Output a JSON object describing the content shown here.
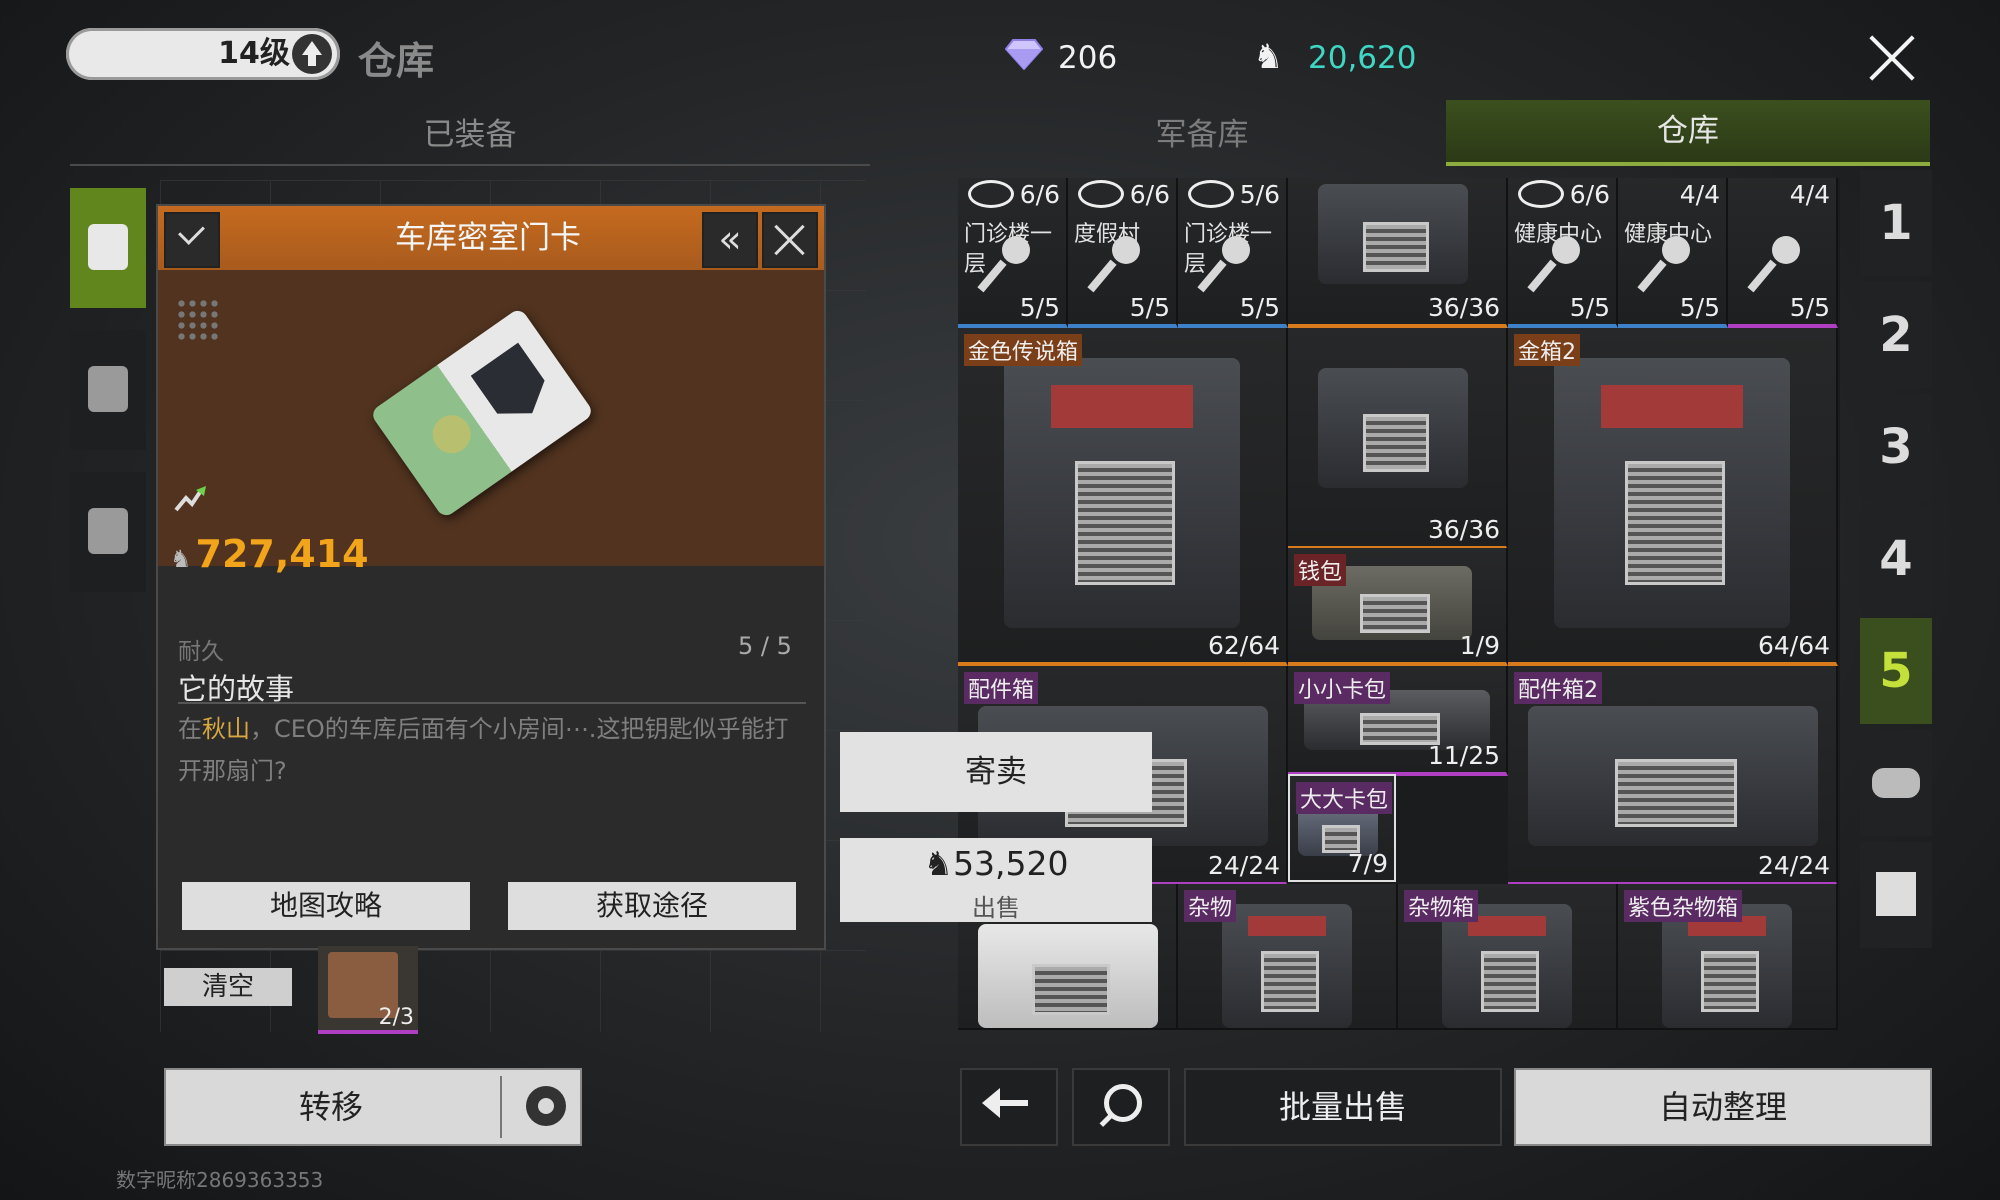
{
  "header": {
    "level": "14级",
    "title": "仓库",
    "gems": "206",
    "coins": "20,620"
  },
  "tabs": {
    "equipped": "已装备",
    "armory": "军备库",
    "warehouse": "仓库"
  },
  "item_popup": {
    "title": "车库密室门卡",
    "price": "727,414",
    "durability_label": "耐久",
    "durability_value": "5 / 5",
    "story_title": "它的故事",
    "story_prefix": "在",
    "story_place": "秋山",
    "story_rest": "，CEO的车库后面有个小房间⋯.这把钥匙似乎能打开那扇门?",
    "btn_map": "地图攻略",
    "btn_source": "获取途径"
  },
  "left_extra": {
    "clear": "清空",
    "small_item_count": "2/3"
  },
  "sell_panel": {
    "consign": "寄卖",
    "price": "53,520",
    "sell": "出售"
  },
  "warehouse": {
    "row1": [
      {
        "top": "6/6",
        "label": "门诊楼一层",
        "count": "5/5"
      },
      {
        "top": "6/6",
        "label": "度假村",
        "count": "5/5"
      },
      {
        "top": "5/6",
        "label": "门诊楼一层",
        "count": "5/5"
      },
      {
        "top": "",
        "label": "",
        "count": "36/36"
      },
      {
        "top": "6/6",
        "label": "健康中心",
        "count": "5/5"
      },
      {
        "top": "4/4",
        "label": "健康中心",
        "count": "5/5"
      },
      {
        "top": "4/4",
        "label": "",
        "count": "5/5"
      }
    ],
    "gold_legend": {
      "tag": "金色传说箱",
      "count": "62/64"
    },
    "ammo_mid": {
      "count": "36/36"
    },
    "wallet": {
      "tag": "钱包",
      "count": "1/9"
    },
    "gold2": {
      "tag": "金箱2",
      "count": "64/64"
    },
    "parts": {
      "tag": "配件箱",
      "count": "24/24"
    },
    "small_card": {
      "tag": "小小卡包",
      "count": "11/25"
    },
    "big_card": {
      "tag": "大大卡包",
      "count": "7/9"
    },
    "parts2": {
      "tag": "配件箱2",
      "count": "24/24"
    },
    "misc": {
      "tag": "杂物"
    },
    "misc_box": {
      "tag": "杂物箱"
    },
    "purple_misc": {
      "tag": "紫色杂物箱"
    }
  },
  "side_numbers": [
    "1",
    "2",
    "3",
    "4",
    "5"
  ],
  "bottom": {
    "transfer": "转移",
    "bulk_sell": "批量出售",
    "auto_sort": "自动整理"
  },
  "footer_id": "数字昵称2869363353"
}
